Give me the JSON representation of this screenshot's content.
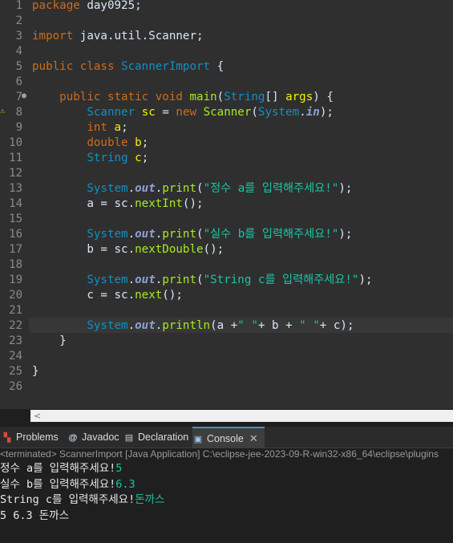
{
  "editor": {
    "line_numbers": [
      "1",
      "2",
      "3",
      "4",
      "5",
      "6",
      "7",
      "8",
      "9",
      "10",
      "11",
      "12",
      "13",
      "14",
      "15",
      "16",
      "17",
      "18",
      "19",
      "20",
      "21",
      "22",
      "23",
      "24",
      "25",
      "26"
    ],
    "lines": [
      [
        {
          "t": "package",
          "c": "kw"
        },
        {
          "t": " day0925;",
          "c": "pl"
        }
      ],
      [],
      [
        {
          "t": "import",
          "c": "kw"
        },
        {
          "t": " java.util.Scanner;",
          "c": "pl"
        }
      ],
      [],
      [
        {
          "t": "public",
          "c": "kw"
        },
        {
          "t": " ",
          "c": "pl"
        },
        {
          "t": "class",
          "c": "kw"
        },
        {
          "t": " ",
          "c": "pl"
        },
        {
          "t": "ScannerImport",
          "c": "ty"
        },
        {
          "t": " {",
          "c": "pl"
        }
      ],
      [],
      [
        {
          "t": "    ",
          "c": "pl"
        },
        {
          "t": "public",
          "c": "kw"
        },
        {
          "t": " ",
          "c": "pl"
        },
        {
          "t": "static",
          "c": "kw"
        },
        {
          "t": " ",
          "c": "pl"
        },
        {
          "t": "void",
          "c": "kw"
        },
        {
          "t": " ",
          "c": "pl"
        },
        {
          "t": "main",
          "c": "fn"
        },
        {
          "t": "(",
          "c": "pl"
        },
        {
          "t": "String",
          "c": "ty"
        },
        {
          "t": "[] ",
          "c": "pl"
        },
        {
          "t": "args",
          "c": "var"
        },
        {
          "t": ") {",
          "c": "pl"
        }
      ],
      [
        {
          "t": "        ",
          "c": "pl"
        },
        {
          "t": "Scanner",
          "c": "ty"
        },
        {
          "t": " ",
          "c": "pl"
        },
        {
          "t": "sc",
          "c": "var"
        },
        {
          "t": " = ",
          "c": "pl"
        },
        {
          "t": "new",
          "c": "kw"
        },
        {
          "t": " ",
          "c": "pl"
        },
        {
          "t": "Scanner",
          "c": "fn"
        },
        {
          "t": "(",
          "c": "pl"
        },
        {
          "t": "System",
          "c": "ty"
        },
        {
          "t": ".",
          "c": "pl"
        },
        {
          "t": "in",
          "c": "st"
        },
        {
          "t": ");",
          "c": "pl"
        }
      ],
      [
        {
          "t": "        ",
          "c": "pl"
        },
        {
          "t": "int",
          "c": "kw"
        },
        {
          "t": " ",
          "c": "pl"
        },
        {
          "t": "a",
          "c": "var"
        },
        {
          "t": ";",
          "c": "pl"
        }
      ],
      [
        {
          "t": "        ",
          "c": "pl"
        },
        {
          "t": "double",
          "c": "kw"
        },
        {
          "t": " ",
          "c": "pl"
        },
        {
          "t": "b",
          "c": "var"
        },
        {
          "t": ";",
          "c": "pl"
        }
      ],
      [
        {
          "t": "        ",
          "c": "pl"
        },
        {
          "t": "String",
          "c": "ty"
        },
        {
          "t": " ",
          "c": "pl"
        },
        {
          "t": "c",
          "c": "var"
        },
        {
          "t": ";",
          "c": "pl"
        }
      ],
      [],
      [
        {
          "t": "        ",
          "c": "pl"
        },
        {
          "t": "System",
          "c": "ty"
        },
        {
          "t": ".",
          "c": "pl"
        },
        {
          "t": "out",
          "c": "st"
        },
        {
          "t": ".",
          "c": "pl"
        },
        {
          "t": "print",
          "c": "fn"
        },
        {
          "t": "(",
          "c": "pl"
        },
        {
          "t": "\"정수 a를 입력해주세요!\"",
          "c": "str"
        },
        {
          "t": ");",
          "c": "pl"
        }
      ],
      [
        {
          "t": "        a = sc.",
          "c": "pl"
        },
        {
          "t": "nextInt",
          "c": "fn"
        },
        {
          "t": "();",
          "c": "pl"
        }
      ],
      [],
      [
        {
          "t": "        ",
          "c": "pl"
        },
        {
          "t": "System",
          "c": "ty"
        },
        {
          "t": ".",
          "c": "pl"
        },
        {
          "t": "out",
          "c": "st"
        },
        {
          "t": ".",
          "c": "pl"
        },
        {
          "t": "print",
          "c": "fn"
        },
        {
          "t": "(",
          "c": "pl"
        },
        {
          "t": "\"실수 b를 입력해주세요!\"",
          "c": "str"
        },
        {
          "t": ");",
          "c": "pl"
        }
      ],
      [
        {
          "t": "        b = sc.",
          "c": "pl"
        },
        {
          "t": "nextDouble",
          "c": "fn"
        },
        {
          "t": "();",
          "c": "pl"
        }
      ],
      [],
      [
        {
          "t": "        ",
          "c": "pl"
        },
        {
          "t": "System",
          "c": "ty"
        },
        {
          "t": ".",
          "c": "pl"
        },
        {
          "t": "out",
          "c": "st"
        },
        {
          "t": ".",
          "c": "pl"
        },
        {
          "t": "print",
          "c": "fn"
        },
        {
          "t": "(",
          "c": "pl"
        },
        {
          "t": "\"String c를 입력해주세요!\"",
          "c": "str"
        },
        {
          "t": ");",
          "c": "pl"
        }
      ],
      [
        {
          "t": "        c = sc.",
          "c": "pl"
        },
        {
          "t": "next",
          "c": "fn"
        },
        {
          "t": "();",
          "c": "pl"
        }
      ],
      [],
      [
        {
          "t": "        ",
          "c": "pl"
        },
        {
          "t": "System",
          "c": "ty"
        },
        {
          "t": ".",
          "c": "pl"
        },
        {
          "t": "out",
          "c": "st"
        },
        {
          "t": ".",
          "c": "pl"
        },
        {
          "t": "println",
          "c": "fn"
        },
        {
          "t": "(a +",
          "c": "pl"
        },
        {
          "t": "\" \"",
          "c": "str"
        },
        {
          "t": "+ b +",
          "c": "pl"
        },
        {
          "t": " \" \"",
          "c": "str"
        },
        {
          "t": "+ c);",
          "c": "pl"
        }
      ],
      [
        {
          "t": "    }",
          "c": "pl"
        }
      ],
      [],
      [
        {
          "t": "}",
          "c": "pl"
        }
      ],
      []
    ],
    "current_line": 22
  },
  "bottom_panel": {
    "tabs": [
      {
        "label": "Problems",
        "icon": "problems-icon"
      },
      {
        "label": "Javadoc",
        "icon": "javadoc-icon"
      },
      {
        "label": "Declaration",
        "icon": "declaration-icon"
      },
      {
        "label": "Console",
        "icon": "console-icon",
        "active": true
      }
    ],
    "console_header": "<terminated> ScannerImport [Java Application] C:\\eclipse-jee-2023-09-R-win32-x86_64\\eclipse\\plugins",
    "console_lines": [
      [
        {
          "t": "정수 a를 입력해주세요!",
          "c": "out"
        },
        {
          "t": "5",
          "c": "in"
        }
      ],
      [
        {
          "t": "실수 b를 입력해주세요!",
          "c": "out"
        },
        {
          "t": "6.3",
          "c": "in"
        }
      ],
      [
        {
          "t": "String c를 입력해주세요!",
          "c": "out"
        },
        {
          "t": "돈까스",
          "c": "in"
        }
      ],
      [
        {
          "t": "5 6.3 돈까스",
          "c": "out"
        }
      ]
    ]
  },
  "colors": {
    "editor_bg": "#2f2f2f",
    "keyword": "#cc6c1d",
    "type": "#1290c3",
    "method": "#a7ec21",
    "string": "#17c6a3",
    "field": "#8ca1d8",
    "variable": "#f2f200",
    "console_input": "#17c6a3"
  }
}
